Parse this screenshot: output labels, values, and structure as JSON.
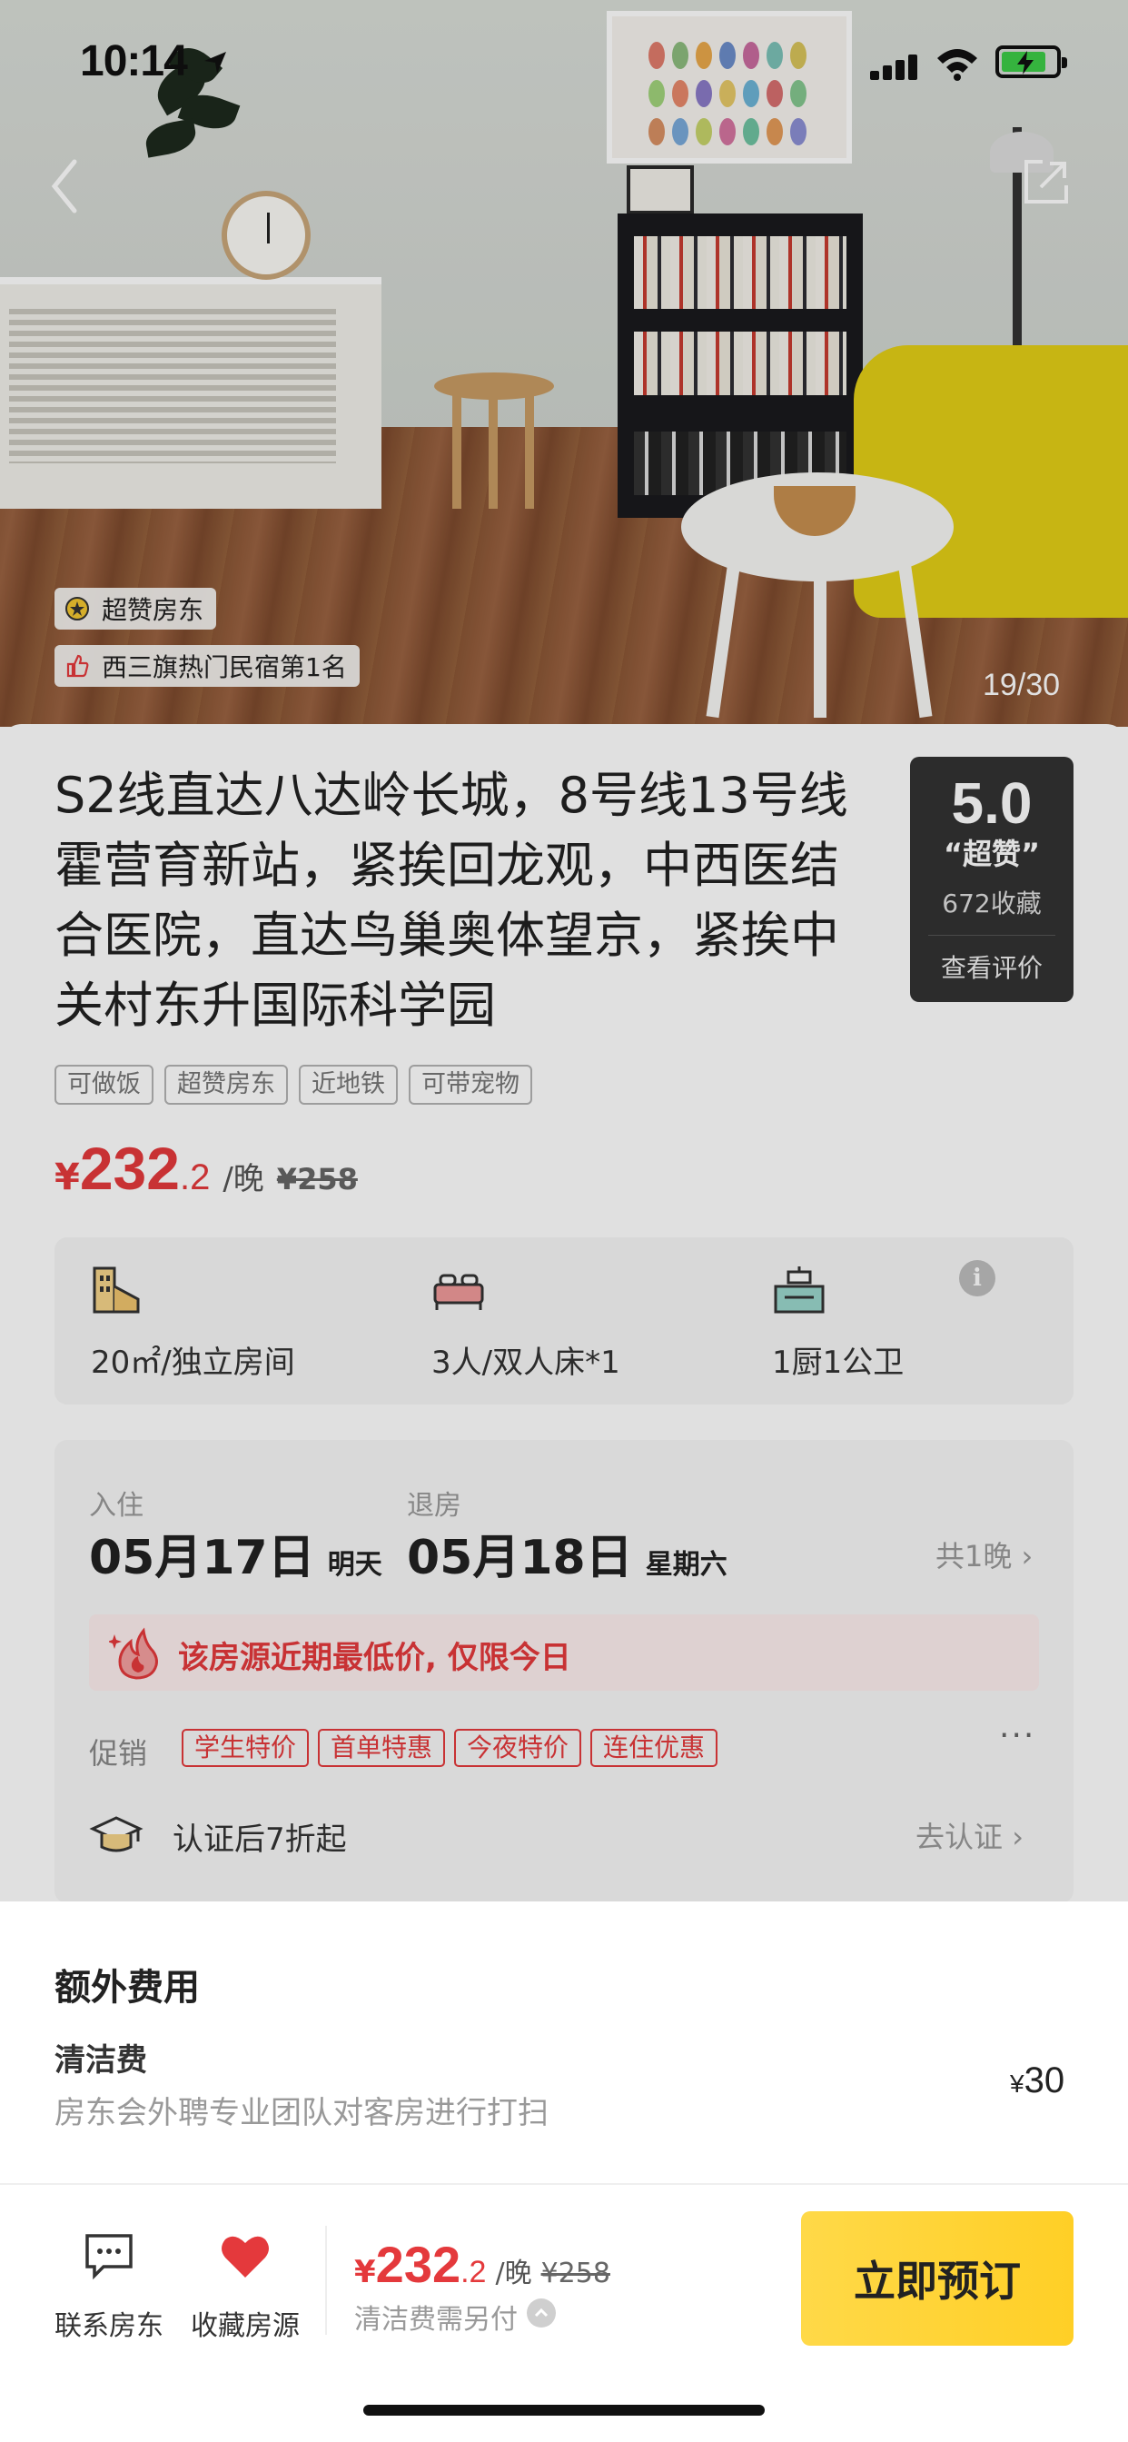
{
  "status_bar": {
    "time": "10:14"
  },
  "hero": {
    "badges": [
      {
        "label": "超赞房东",
        "icon": "super-host-icon"
      },
      {
        "label": "西三旗热门民宿第1名",
        "icon": "thumbs-up-icon"
      }
    ],
    "photo_counter": "19/30"
  },
  "listing": {
    "title": "S2线直达八达岭长城，8号线13号线霍营育新站，紧挨回龙观，中西医结合医院，直达鸟巢奥体望京，紧挨中关村东升国际科学园",
    "rating": {
      "score": "5.0",
      "word": "“超赞”",
      "favorites": "672收藏",
      "view_reviews": "查看评价"
    },
    "tags": [
      "可做饭",
      "超赞房东",
      "近地铁",
      "可带宠物"
    ],
    "price": {
      "currency": "¥",
      "integer": "232",
      "decimal": ".2",
      "unit": "/晚",
      "original": "¥258"
    },
    "facilities": [
      {
        "label": "20㎡/独立房间",
        "icon": "building-icon"
      },
      {
        "label": "3人/双人床*1",
        "icon": "bed-icon"
      },
      {
        "label": "1厨1公卫",
        "icon": "kitchen-icon"
      }
    ]
  },
  "booking": {
    "checkin_label": "入住",
    "checkin_date": "05月17日",
    "checkin_day": "明天",
    "checkout_label": "退房",
    "checkout_date": "05月18日",
    "checkout_day": "星期六",
    "nights": "共1晚",
    "lowest_notice": "该房源近期最低价, 仅限今日",
    "promo_label": "促销",
    "promos": [
      "学生特价",
      "首单特惠",
      "今夜特价",
      "连住优惠"
    ],
    "more": "···",
    "cert_text": "认证后7折起",
    "cert_action": "去认证"
  },
  "extra_fees": {
    "title": "额外费用",
    "fee_name": "清洁费",
    "fee_desc": "房东会外聘专业团队对客房进行打扫",
    "fee_currency": "¥",
    "fee_value": "30"
  },
  "bottom_bar": {
    "contact_label": "联系房东",
    "favorite_label": "收藏房源",
    "price": {
      "currency": "¥",
      "integer": "232",
      "decimal": ".2",
      "unit": "/晚",
      "original": "¥258"
    },
    "clean_note": "清洁费需另付",
    "book_label": "立即预订"
  },
  "colors": {
    "accent_red": "#e4393c",
    "book_yellow": "#ffd23a",
    "rating_bg": "#333333"
  }
}
